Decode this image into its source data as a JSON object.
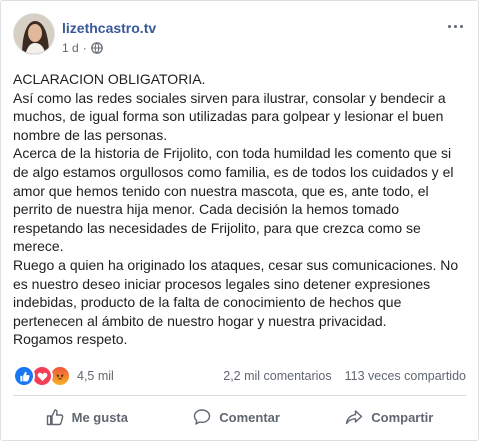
{
  "post": {
    "author": "lizethcastro.tv",
    "time": "1 d",
    "separator": "·",
    "audience_icon": "globe-icon",
    "body_lines": [
      "ACLARACION OBLIGATORIA.",
      "Así como las redes sociales sirven para ilustrar, consolar y bendecir a",
      "muchos, de igual forma son utilizadas para golpear y lesionar el buen",
      "nombre de las personas.",
      "Acerca de la historia de Frijolito, con toda humildad les comento que si",
      "de algo estamos orgullosos como familia, es de todos los cuidados y el",
      "amor que hemos tenido con nuestra mascota, que es, ante todo, el",
      "perrito de nuestra hija menor. Cada decisión la hemos tomado",
      "respetando las necesidades de Frijolito, para que crezca como se",
      "merece.",
      "Ruego a quien ha originado los ataques, cesar sus comunicaciones. No",
      "es nuestro deseo iniciar procesos legales sino detener expresiones",
      "indebidas, producto de la falta de conocimiento de hechos que",
      "pertenecen al ámbito de nuestro hogar y nuestra privacidad.",
      "Rogamos respeto."
    ]
  },
  "stats": {
    "reaction_icons": [
      "like-reaction-icon",
      "love-reaction-icon",
      "angry-reaction-icon"
    ],
    "reaction_count": "4,5 mil",
    "comments": "2,2 mil comentarios",
    "shares": "113 veces compartido"
  },
  "actions": {
    "like": "Me gusta",
    "comment": "Comentar",
    "share": "Compartir"
  },
  "colors": {
    "author_link": "#385898",
    "like_blue": "#1877f2",
    "love_red": "#f33e58",
    "secondary_text": "#606770"
  }
}
